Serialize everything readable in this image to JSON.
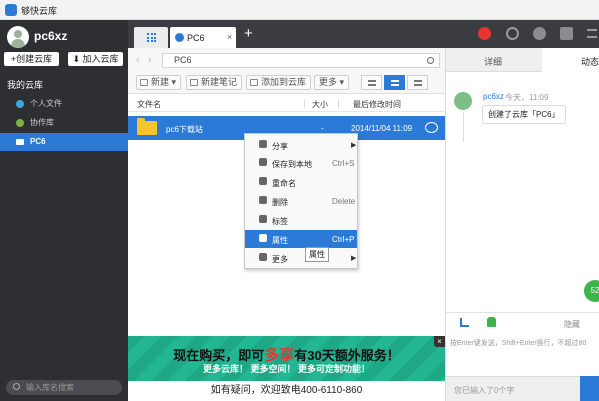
{
  "titlebar": {
    "title": "够快云库"
  },
  "sidebar": {
    "username": "pc6xz",
    "create_button": "+创建云库",
    "join_button": "加入云库",
    "section_title": "我的云库",
    "items": [
      {
        "label": "个人文件",
        "icon": "personal-files-icon",
        "color": "#3ba6d9"
      },
      {
        "label": "协作库",
        "icon": "collab-library-icon",
        "color": "#7cb342"
      },
      {
        "label": "PC6",
        "icon": "library-icon",
        "active": true
      }
    ],
    "search_placeholder": "输入库名搜索"
  },
  "tabs": {
    "active_tab": "PC6",
    "close": "×",
    "add": "+"
  },
  "address": {
    "path": "PC6",
    "back": "‹",
    "forward": "›"
  },
  "toolbar": {
    "new_label": "新建",
    "new_note_label": "新建笔记",
    "add_label": "添加到云库",
    "more_label": "更多"
  },
  "columns": {
    "name": "文件名",
    "size": "大小",
    "modified": "最后修改时间"
  },
  "files": [
    {
      "name": "pc6下载站",
      "size": "-",
      "modified": "2014/11/04 11:09"
    }
  ],
  "context_menu": {
    "items": [
      {
        "label": "分享",
        "shortcut": "",
        "submenu": true
      },
      {
        "label": "保存到本地",
        "shortcut": "Ctrl+S"
      },
      {
        "label": "重命名",
        "shortcut": ""
      },
      {
        "label": "删除",
        "shortcut": "Delete"
      },
      {
        "label": "标签",
        "shortcut": ""
      },
      {
        "label": "属性",
        "shortcut": "Ctrl+P",
        "highlighted": true
      },
      {
        "label": "更多",
        "shortcut": "",
        "submenu": true
      }
    ],
    "tooltip": "属性"
  },
  "right_panel": {
    "tab_detail": "详细",
    "tab_activity": "动态",
    "feed": {
      "user": "pc6xz",
      "time": "今天，11:09",
      "message": "创建了云库「PC6」"
    },
    "float_button": "52",
    "hide_label": "隐藏",
    "hint": "按Enter键发送，Shift+Enter换行，不超过80",
    "input_placeholder": "您已输入了0个字"
  },
  "banner": {
    "line1_a": "现在购买，即可",
    "line1_hl": "多享",
    "line1_b": "有30天额外服务！",
    "line2": "更多云库！ 更多空间！ 更多可定制功能！",
    "line3": "如有疑问，欢迎致电400-6110-860",
    "close": "×"
  },
  "colors": {
    "accent": "#2b7ad7",
    "sidebar_bg": "#2d2f33",
    "banner_bg": "#21b08e"
  }
}
